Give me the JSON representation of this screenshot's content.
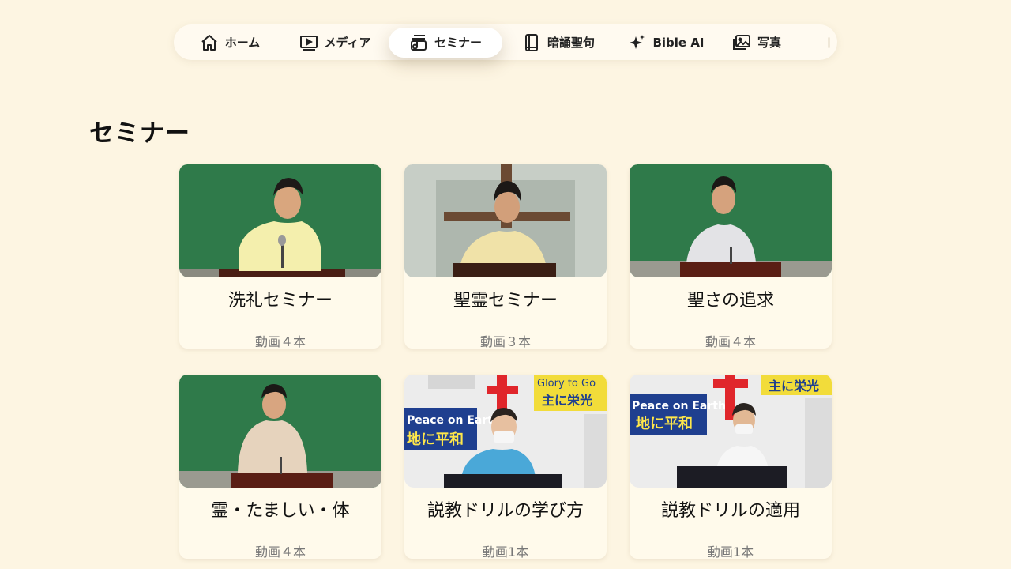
{
  "nav": {
    "items": [
      {
        "label": "ホーム",
        "icon": "home-icon",
        "active": false
      },
      {
        "label": "メディア",
        "icon": "media-icon",
        "active": false
      },
      {
        "label": "セミナー",
        "icon": "seminar-icon",
        "active": true
      },
      {
        "label": "暗誦聖句",
        "icon": "book-icon",
        "active": false
      },
      {
        "label": "Bible AI",
        "icon": "sparkle-icon",
        "active": false
      },
      {
        "label": "写真",
        "icon": "photos-icon",
        "active": false
      }
    ]
  },
  "page": {
    "title": "セミナー"
  },
  "cards": [
    {
      "title": "洗礼セミナー",
      "count": "動画４本",
      "thumbnail": "speaker-green-board-yellow-shirt"
    },
    {
      "title": "聖霊セミナー",
      "count": "動画３本",
      "thumbnail": "speaker-cross-podium"
    },
    {
      "title": "聖さの追求",
      "count": "動画４本",
      "thumbnail": "speaker-green-board-white-shirt"
    },
    {
      "title": "霊・たましい・体",
      "count": "動画４本",
      "thumbnail": "speaker-green-board-beige-jacket"
    },
    {
      "title": "説教ドリルの学び方",
      "count": "動画1本",
      "thumbnail": "church-banners-speaker-blue",
      "banner_text": {
        "left": "Peace on Earth",
        "left_sub": "地に平和",
        "right": "Glory to Go",
        "right_sub": "主に栄光"
      }
    },
    {
      "title": "説教ドリルの適用",
      "count": "動画1本",
      "thumbnail": "church-banners-speaker-white",
      "banner_text": {
        "left": "Peace on Earth",
        "left_sub": "地に平和",
        "right": "主に栄光"
      }
    }
  ],
  "colors": {
    "background": "#fdf5e2",
    "card": "#fffaeb",
    "chalkboard": "#2f7a4a",
    "cross_red": "#e0262b"
  }
}
